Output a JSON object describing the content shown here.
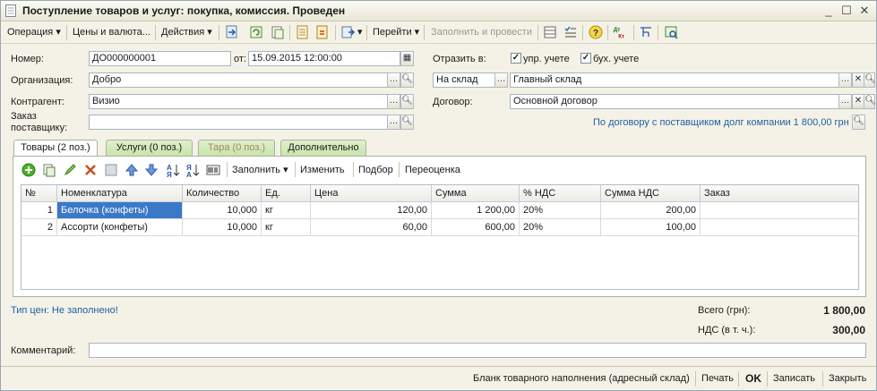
{
  "window": {
    "title": "Поступление товаров и услуг: покупка, комиссия. Проведен"
  },
  "toolbar": {
    "operation": "Операция",
    "prices": "Цены и валюта...",
    "actions": "Действия",
    "goto": "Перейти",
    "fill_post": "Заполнить и провести"
  },
  "header": {
    "number_label": "Номер:",
    "number_value": "ДО000000001",
    "date_label": "от:",
    "date_value": "15.09.2015 12:00:00",
    "reflect_label": "Отразить в:",
    "upr_label": "упр. учете",
    "buh_label": "бух. учете",
    "org_label": "Организация:",
    "org_value": "Добро",
    "warehouse_type": "На склад",
    "warehouse_value": "Главный склад",
    "counterparty_label": "Контрагент:",
    "counterparty_value": "Визио",
    "contract_label": "Договор:",
    "contract_value": "Основной договор",
    "order_label_1": "Заказ",
    "order_label_2": "поставщику:",
    "order_value": "",
    "debt_info": "По договору с поставщиком долг компании 1 800,00 грн"
  },
  "tabs": [
    "Товары (2 поз.)",
    "Услуги (0 поз.)",
    "Тара (0 поз.)",
    "Дополнительно"
  ],
  "table_toolbar": {
    "fill": "Заполнить",
    "change": "Изменить",
    "select": "Подбор",
    "reprice": "Переоценка"
  },
  "table": {
    "columns": [
      "№",
      "Номенклатура",
      "Количество",
      "Ед.",
      "Цена",
      "Сумма",
      "% НДС",
      "Сумма НДС",
      "Заказ"
    ],
    "rows": [
      [
        "1",
        "Белочка (конфеты)",
        "10,000",
        "кг",
        "120,00",
        "1 200,00",
        "20%",
        "200,00",
        ""
      ],
      [
        "2",
        "Ассорти (конфеты)",
        "10,000",
        "кг",
        "60,00",
        "600,00",
        "20%",
        "100,00",
        ""
      ]
    ]
  },
  "summary": {
    "price_type": "Тип цен: Не заполнено!",
    "total_label": "Всего (грн):",
    "total_value": "1 800,00",
    "vat_label": "НДС (в т. ч.):",
    "vat_value": "300,00"
  },
  "comment": {
    "label": "Комментарий:",
    "value": ""
  },
  "footer": {
    "blank": "Бланк товарного наполнения (адресный склад)",
    "print": "Печать",
    "ok": "OK",
    "save": "Записать",
    "close": "Закрыть"
  }
}
